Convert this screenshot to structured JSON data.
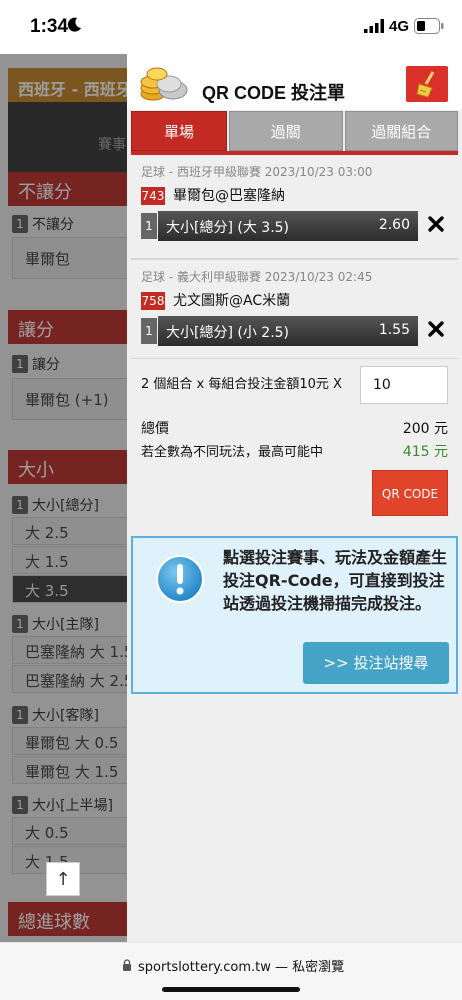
{
  "status_bar": {
    "time": "1:34",
    "network": "4G"
  },
  "background_page": {
    "match_title": "西班牙 - 西班牙",
    "match_sub": "賽事",
    "sections": [
      {
        "heading": "不讓分",
        "label_num": "1",
        "label": "不讓分",
        "option": "畢爾包"
      },
      {
        "heading": "讓分",
        "label_num": "1",
        "label": "讓分",
        "option": "畢爾包 (+1)"
      },
      {
        "heading": "大小"
      }
    ],
    "over_under_total": {
      "label_num": "1",
      "label": "大小[總分]",
      "options": [
        "大 2.5",
        "大 1.5",
        "大 3.5"
      ]
    },
    "over_under_home": {
      "label_num": "1",
      "label": "大小[主隊]",
      "options": [
        "巴塞隆納 大 1.5",
        "巴塞隆納 大 2.5"
      ]
    },
    "over_under_away": {
      "label_num": "1",
      "label": "大小[客隊]",
      "options": [
        "畢爾包 大 0.5",
        "畢爾包 大 1.5"
      ]
    },
    "over_under_half": {
      "label_num": "1",
      "label": "大小[上半場]",
      "options": [
        "大 0.5",
        "大 1.5"
      ]
    },
    "last_heading": "總進球數",
    "scroll_top": "↑"
  },
  "panel": {
    "title": "QR CODE 投注單",
    "tabs": [
      "單場",
      "過關",
      "過關組合"
    ],
    "bets": [
      {
        "league": "足球 - 西班牙甲級聯賽 2023/10/23 03:00",
        "code": "743",
        "teams": "畢爾包@巴塞隆納",
        "num": "1",
        "selection": "大小[總分] (大 3.5)",
        "odds": "2.60"
      },
      {
        "league": "足球 - 義大利甲級聯賽 2023/10/23 02:45",
        "code": "758",
        "teams": "尤文圖斯@AC米蘭",
        "num": "1",
        "selection": "大小[總分] (小 2.5)",
        "odds": "1.55"
      }
    ],
    "combo_text": "2 個組合 x 每組合投注金額10元 X",
    "amount_value": "10",
    "total_label": "總價",
    "total_value": "200 元",
    "max_label": "若全數為不同玩法，最高可能中",
    "max_value": "415 元",
    "qr_button": "QR CODE",
    "info_text": "點選投注賽事、玩法及金額產生投注QR-Code，可直接到投注站透過投注機掃描完成投注。",
    "search_button": ">> 投注站搜尋"
  },
  "browser": {
    "url": "sportslottery.com.tw — 私密瀏覽"
  },
  "colors": {
    "accent_red": "#c42a24",
    "qr_orange": "#e0442a",
    "info_blue": "#45a3c8",
    "win_green": "#3a8a2a"
  }
}
